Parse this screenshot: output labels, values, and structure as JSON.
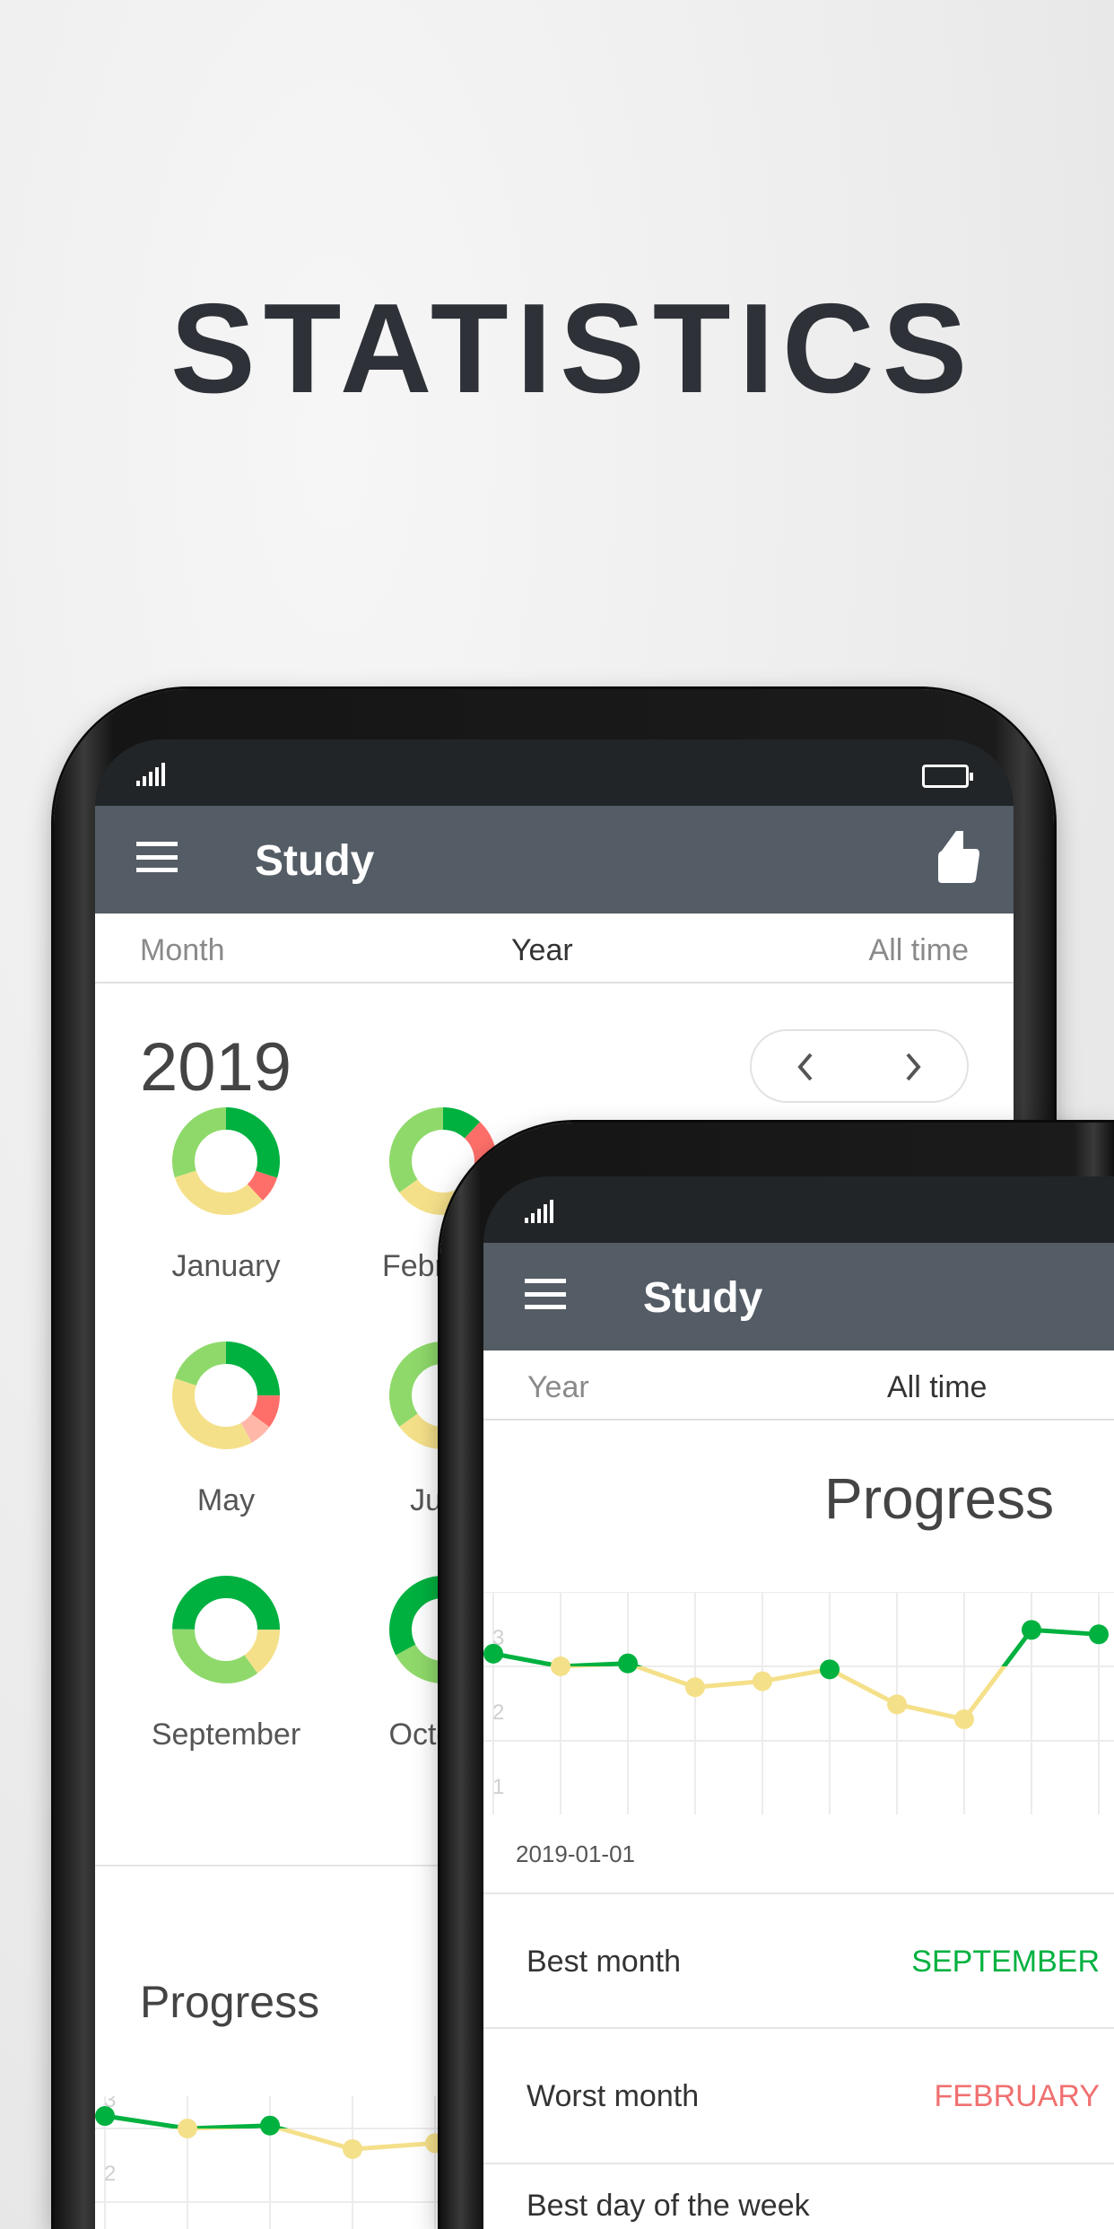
{
  "headline": "STATISTICS",
  "colors": {
    "dark_green": "#00b140",
    "light_green": "#8fd96b",
    "yellow": "#f5e08a",
    "red": "#ff6f6a",
    "pink": "#ffb8a8",
    "appbar": "#545c65",
    "status": "#212528"
  },
  "back_phone": {
    "app_title": "Study",
    "icons": [
      "signal-icon",
      "battery-icon",
      "menu-icon",
      "thumbs-up-icon",
      "chevron-left-icon",
      "chevron-right-icon"
    ],
    "tabs": [
      {
        "label": "Month"
      },
      {
        "label": "Year",
        "active": true
      },
      {
        "label": "All time"
      }
    ],
    "year": "2019",
    "months": [
      {
        "label": "January",
        "segments": [
          {
            "c": "dark_green",
            "v": 0.3
          },
          {
            "c": "red",
            "v": 0.08
          },
          {
            "c": "yellow",
            "v": 0.32
          },
          {
            "c": "light_green",
            "v": 0.3
          }
        ]
      },
      {
        "label": "February",
        "segments": [
          {
            "c": "dark_green",
            "v": 0.12
          },
          {
            "c": "red",
            "v": 0.2
          },
          {
            "c": "yellow",
            "v": 0.33
          },
          {
            "c": "light_green",
            "v": 0.35
          }
        ]
      },
      {
        "label": "May",
        "segments": [
          {
            "c": "dark_green",
            "v": 0.25
          },
          {
            "c": "red",
            "v": 0.1
          },
          {
            "c": "pink",
            "v": 0.07
          },
          {
            "c": "yellow",
            "v": 0.38
          },
          {
            "c": "light_green",
            "v": 0.2
          }
        ]
      },
      {
        "label": "June",
        "segments": [
          {
            "c": "dark_green",
            "v": 0.1
          },
          {
            "c": "light_green",
            "v": 0.2
          },
          {
            "c": "yellow",
            "v": 0.35
          },
          {
            "c": "light_green",
            "v": 0.35
          }
        ]
      },
      {
        "label": "September",
        "segments": [
          {
            "c": "dark_green",
            "v": 0.25
          },
          {
            "c": "yellow",
            "v": 0.15
          },
          {
            "c": "light_green",
            "v": 0.35
          },
          {
            "c": "dark_green",
            "v": 0.25
          }
        ]
      },
      {
        "label": "October",
        "segments": [
          {
            "c": "dark_green",
            "v": 0.5
          },
          {
            "c": "light_green",
            "v": 0.17
          },
          {
            "c": "dark_green",
            "v": 0.33
          }
        ]
      }
    ],
    "progress_title": "Progress"
  },
  "front_phone": {
    "app_title": "Study",
    "tabs": [
      {
        "label": "Year"
      },
      {
        "label": "All time",
        "active": true
      }
    ],
    "progress_title": "Progress",
    "start_date": "2019-01-01",
    "stats": [
      {
        "label": "Best month",
        "value": "SEPTEMBER",
        "color": "#00b140"
      },
      {
        "label": "Worst month",
        "value": "FEBRUARY",
        "color": "#f07070"
      },
      {
        "label": "Best day of the week",
        "value": ""
      }
    ]
  },
  "chart_data": {
    "type": "line",
    "y_ticks": [
      "3",
      "2",
      "1"
    ],
    "ylim": [
      1,
      4
    ],
    "threshold": 3,
    "grid": true,
    "values": [
      3.17,
      3.0,
      3.04,
      2.72,
      2.8,
      2.96,
      2.49,
      2.29,
      3.49,
      3.43
    ],
    "point_colors": [
      "dark_green",
      "yellow",
      "dark_green",
      "yellow",
      "yellow",
      "dark_green",
      "yellow",
      "yellow",
      "dark_green",
      "dark_green"
    ]
  }
}
